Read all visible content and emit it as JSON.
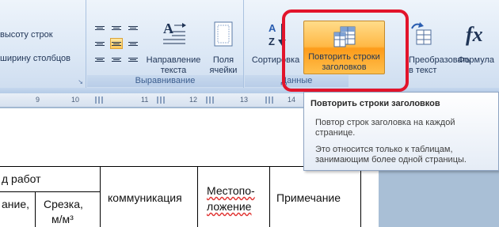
{
  "ribbon": {
    "size_group": {
      "items": [
        "высоту строк",
        "ширину столбцов"
      ]
    },
    "alignment_group": {
      "label": "Выравнивание",
      "text_direction_label": "Направление\nтекста",
      "cell_margins_label": "Поля\nячейки"
    },
    "data_group": {
      "label": "Данные",
      "sort_label": "Сортировка",
      "repeat_header_label": "Повторить строки\nзаголовков",
      "convert_label": "Преобразовать\nв текст",
      "formula_label": "Формула"
    }
  },
  "ruler": {
    "marks": [
      "9",
      "10",
      "11",
      "12",
      "13",
      "14"
    ]
  },
  "tooltip": {
    "title": "Повторить строки заголовков",
    "line1": "Повтор строк заголовка на каждой",
    "line2": "странице.",
    "line3": "Это относится только к таблицам,",
    "line4": "занимающим более одной страницы."
  },
  "table": {
    "header_main": "д работ",
    "sub_a": "ание,",
    "sub_b": "Срезка,",
    "sub_b_unit": "м/м³",
    "col_comm": "коммуникация",
    "col_place_1": "Местопо-",
    "col_place_2": "ложение",
    "col_note": "Примечание"
  },
  "colors": {
    "highlight": "#e2142b",
    "button_active": "#ffb845",
    "ribbon_bg": "#dbe7f5"
  }
}
